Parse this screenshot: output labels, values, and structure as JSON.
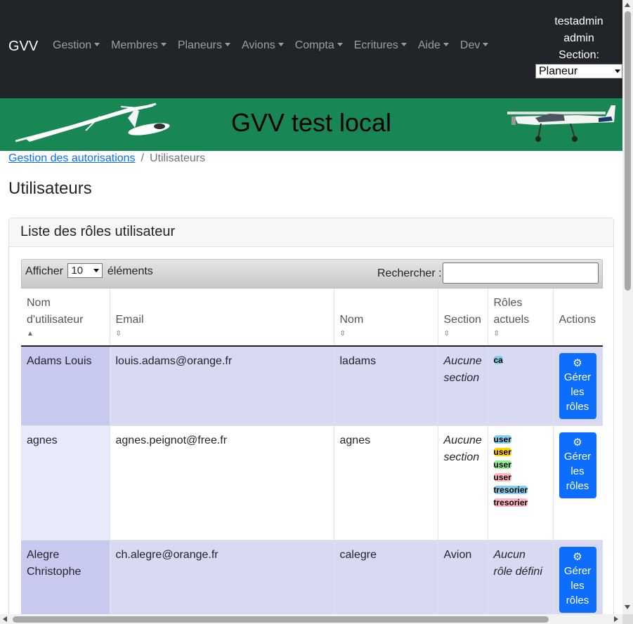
{
  "navbar": {
    "brand": "GVV",
    "menu": [
      "Gestion",
      "Membres",
      "Planeurs",
      "Avions",
      "Compta",
      "Ecritures",
      "Aide",
      "Dev"
    ],
    "username": "testadmin",
    "role": "admin",
    "section_label": "Section:",
    "section_value": "Planeur"
  },
  "banner": {
    "title": "GVV test local",
    "bg_color": "#198754"
  },
  "breadcrumb": {
    "parent": "Gestion des autorisations",
    "current": "Utilisateurs"
  },
  "page_title": "Utilisateurs",
  "card": {
    "title": "Liste des rôles utilisateur",
    "length": {
      "prefix": "Afficher",
      "value": "10",
      "suffix": "éléments"
    },
    "search_label": "Rechercher :",
    "columns": [
      "Nom d'utilisateur",
      "Email",
      "Nom",
      "Section",
      "Rôles actuels",
      "Actions"
    ],
    "rows": [
      {
        "username": "Adams Louis",
        "email": "louis.adams@orange.fr",
        "nom": "ladams",
        "section": "Aucune section",
        "roles": [
          {
            "label": "ca",
            "color": "blue"
          }
        ],
        "action": "Gérer les rôles"
      },
      {
        "username": "agnes",
        "email": "agnes.peignot@free.fr",
        "nom": "agnes",
        "section": "Aucune section",
        "roles": [
          {
            "label": "user",
            "color": "blue"
          },
          {
            "label": "user",
            "color": "yellow"
          },
          {
            "label": "user",
            "color": "green"
          },
          {
            "label": "user",
            "color": "pink"
          },
          {
            "label": "tresorier",
            "color": "blue"
          },
          {
            "label": "tresorier",
            "color": "pink"
          }
        ],
        "action": "Gérer les rôles"
      },
      {
        "username": "Alegre Christophe",
        "email": "ch.alegre@orange.fr",
        "nom": "calegre",
        "section": "Avion",
        "roles_text": "Aucun rôle défini",
        "action": "Gérer les rôles"
      }
    ]
  },
  "icons": {
    "caret": "caret-down-icon",
    "gear": "gear-icon",
    "sort": "sort-icon"
  }
}
